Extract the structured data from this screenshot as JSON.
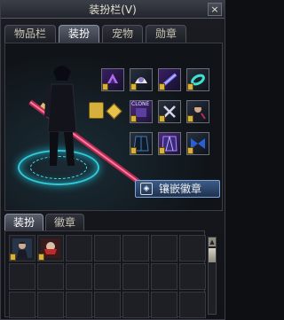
{
  "window": {
    "title": "装扮栏(V)",
    "close_label": "×"
  },
  "tabs": [
    {
      "label": "物品栏",
      "active": false
    },
    {
      "label": "装扮",
      "active": true
    },
    {
      "label": "宠物",
      "active": false
    },
    {
      "label": "勋章",
      "active": false
    }
  ],
  "equipment": {
    "slots": [
      {
        "name": "hair-avatar",
        "icon": "purple-hair-icon",
        "locked": true
      },
      {
        "name": "hat-avatar",
        "icon": "white-hat-icon",
        "locked": true
      },
      {
        "name": "face-avatar",
        "icon": "blue-band-icon",
        "locked": true
      },
      {
        "name": "neck-avatar",
        "icon": "cyan-ring-icon",
        "locked": true
      },
      {
        "name": "coat-avatar",
        "icon": "clone-icon",
        "locked": true
      },
      {
        "name": "skin-avatar",
        "icon": "swirl-icon",
        "locked": true
      },
      {
        "name": "weapon-avatar",
        "icon": "character-portrait-icon",
        "locked": true
      },
      {
        "name": "pants-avatar",
        "icon": "dark-coat-icon",
        "locked": true
      },
      {
        "name": "belt-avatar",
        "icon": "violet-coat-icon",
        "locked": true
      },
      {
        "name": "shoes-avatar",
        "icon": "violet-pants-icon",
        "locked": true
      },
      {
        "name": "shoes2-avatar",
        "icon": "blue-wing-icon",
        "locked": true
      }
    ],
    "slot_text": "CLONE",
    "inlay_button_label": "镶嵌徽章"
  },
  "sub_tabs": [
    {
      "label": "装扮",
      "active": true
    },
    {
      "label": "徽章",
      "active": false
    }
  ],
  "inventory": {
    "items": [
      {
        "icon": "character-portrait-icon",
        "locked": true
      },
      {
        "icon": "red-mask-icon",
        "locked": true
      }
    ],
    "empty_slots": 19
  }
}
